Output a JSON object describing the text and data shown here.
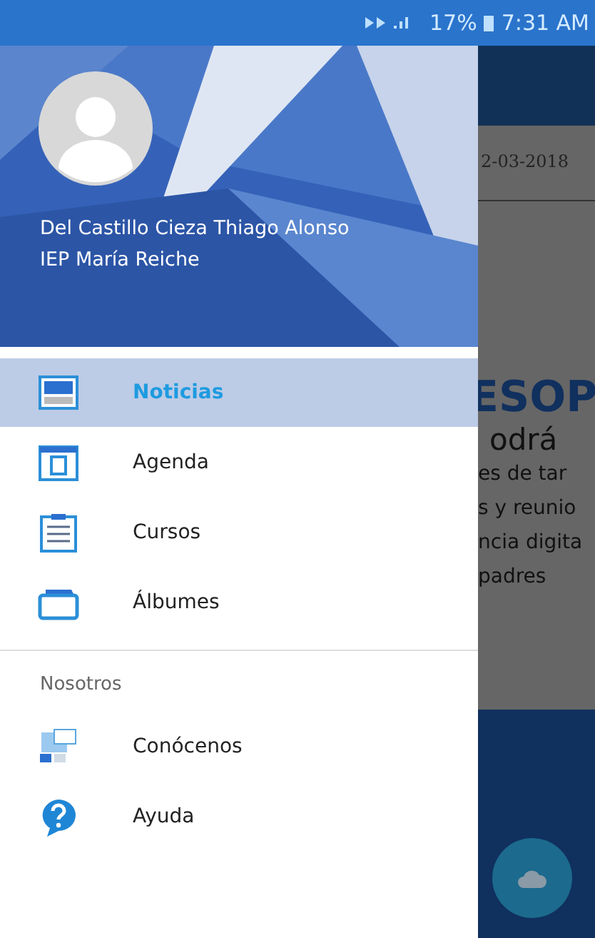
{
  "status_bar": {
    "battery": "17%",
    "time": "7:31 AM"
  },
  "drawer": {
    "user_name": "Del Castillo Cieza Thiago Alonso",
    "school": "IEP María Reiche",
    "items": [
      {
        "label": "Noticias",
        "kind": "news",
        "selected": true
      },
      {
        "label": "Agenda",
        "kind": "calendar",
        "selected": false
      },
      {
        "label": "Cursos",
        "kind": "clipboard",
        "selected": false
      },
      {
        "label": "Álbumes",
        "kind": "folder",
        "selected": false
      }
    ],
    "section": "Nosotros",
    "section_items": [
      {
        "label": "Conócenos",
        "kind": "about",
        "selected": false
      },
      {
        "label": "Ayuda",
        "kind": "help",
        "selected": false
      }
    ]
  },
  "background": {
    "date": "2-03-2018",
    "heading": "ESOP",
    "lines": [
      "odrá",
      "es de tar",
      "s y reunio",
      "ncia digita",
      "padres"
    ]
  }
}
